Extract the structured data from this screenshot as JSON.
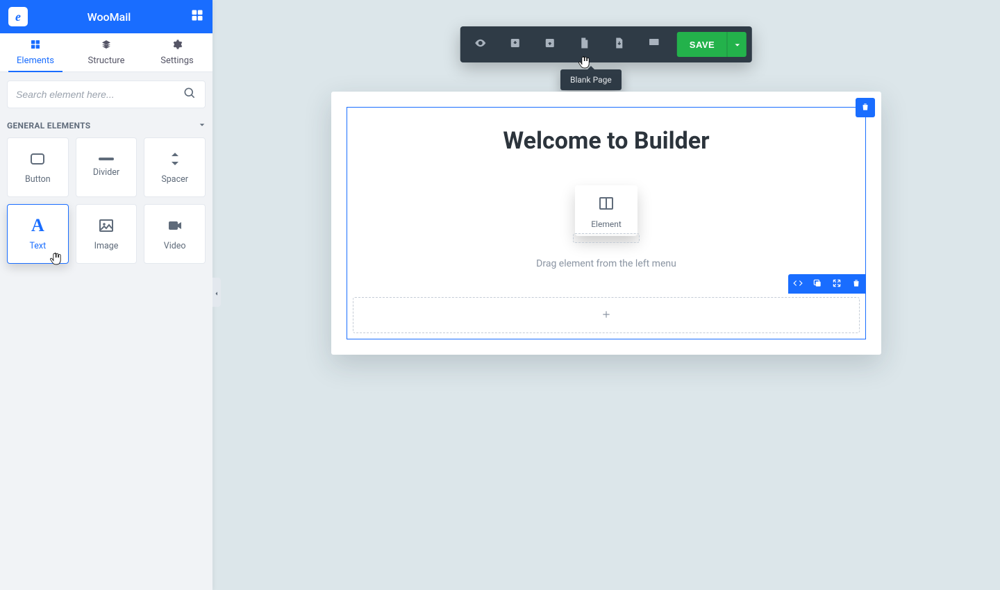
{
  "brand": {
    "title": "WooMail",
    "logo_letter": "e"
  },
  "tabs": {
    "elements": "Elements",
    "structure": "Structure",
    "settings": "Settings"
  },
  "search": {
    "placeholder": "Search element here..."
  },
  "section": {
    "general_title": "GENERAL ELEMENTS"
  },
  "elements": {
    "button": "Button",
    "divider": "Divider",
    "spacer": "Spacer",
    "text": "Text",
    "image": "Image",
    "video": "Video"
  },
  "toolbar": {
    "tooltip_blank_page": "Blank Page",
    "save_label": "SAVE"
  },
  "canvas": {
    "heading": "Welcome to Builder",
    "ghost_label": "Element",
    "hint": "Drag element from the left menu"
  }
}
